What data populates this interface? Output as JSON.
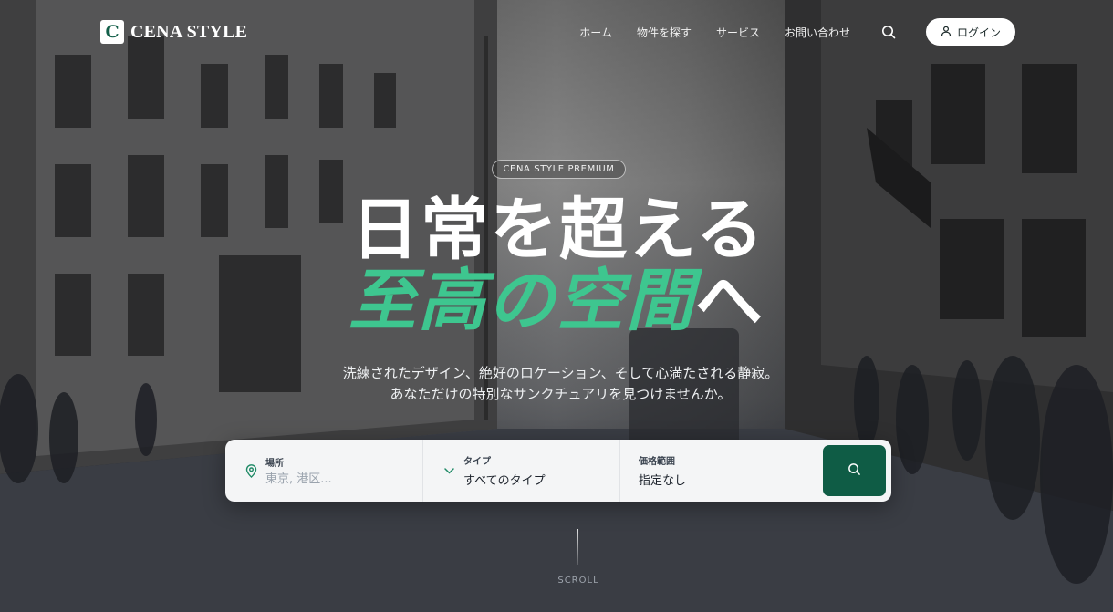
{
  "brand": {
    "mark": "C",
    "name": "CENA STYLE"
  },
  "nav": {
    "items": [
      {
        "label": "ホーム"
      },
      {
        "label": "物件を探す"
      },
      {
        "label": "サービス"
      },
      {
        "label": "お問い合わせ"
      }
    ],
    "search_icon": "search-icon",
    "login_label": "ログイン",
    "login_icon": "user-icon"
  },
  "hero": {
    "badge": "CENA STYLE PREMIUM",
    "headline_line1": "日常を超える",
    "headline_line2_accent": "至高の空間",
    "headline_line2_rest": "へ",
    "subtext_line1": "洗練されたデザイン、絶好のロケーション、そして心満たされる静寂。",
    "subtext_line2": "あなただけの特別なサンクチュアリを見つけませんか。"
  },
  "search": {
    "location": {
      "label": "場所",
      "placeholder": "東京, 港区...",
      "icon": "map-pin-icon"
    },
    "type": {
      "label": "タイプ",
      "value": "すべてのタイプ",
      "icon": "chevron-down-icon"
    },
    "price": {
      "label": "価格範囲",
      "value": "指定なし"
    },
    "submit_icon": "search-icon"
  },
  "scroll": {
    "label": "SCROLL"
  },
  "colors": {
    "accent": "#3ec68f",
    "brand_green": "#0f5c45",
    "searchbar_bg": "#f4f5f6"
  }
}
